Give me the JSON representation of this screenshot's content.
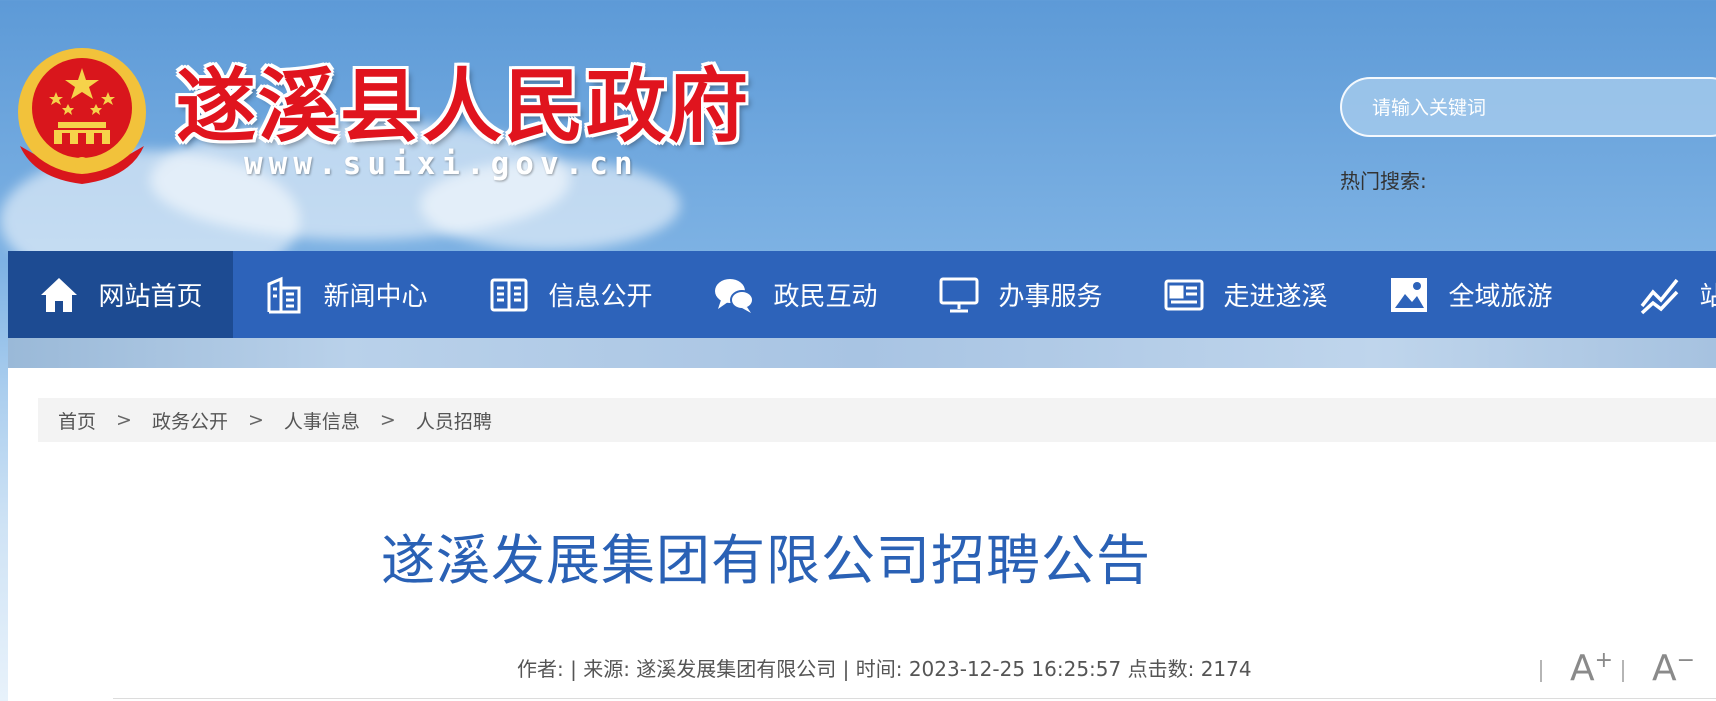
{
  "header": {
    "site_title": "遂溪县人民政府",
    "site_url": "www.suixi.gov.cn",
    "search_placeholder": "请输入关键词",
    "hot_search_label": "热门搜索:"
  },
  "colors": {
    "nav_bg": "#2d63ba",
    "nav_active_bg": "#1d4b92",
    "title_red": "#e0141e",
    "article_title_blue": "#2a61b5"
  },
  "nav": {
    "items": [
      {
        "label": "网站首页",
        "icon": "home-icon"
      },
      {
        "label": "新闻中心",
        "icon": "news-building-icon"
      },
      {
        "label": "信息公开",
        "icon": "open-book-icon"
      },
      {
        "label": "政民互动",
        "icon": "chat-bubbles-icon"
      },
      {
        "label": "办事服务",
        "icon": "monitor-icon"
      },
      {
        "label": "走进遂溪",
        "icon": "newspaper-icon"
      },
      {
        "label": "全域旅游",
        "icon": "picture-icon"
      },
      {
        "label": "站群",
        "icon": "trend-chart-icon"
      }
    ]
  },
  "breadcrumb": {
    "items": [
      "首页",
      "政务公开",
      "人事信息",
      "人员招聘"
    ],
    "separator": ">"
  },
  "article": {
    "title": "遂溪发展集团有限公司招聘公告",
    "meta": "作者: | 来源: 遂溪发展集团有限公司 | 时间: 2023-12-25 16:25:57 点击数: 2174"
  },
  "font_controls": {
    "increase_label": "A",
    "increase_sign": "+",
    "decrease_label": "A",
    "decrease_sign": "−"
  }
}
